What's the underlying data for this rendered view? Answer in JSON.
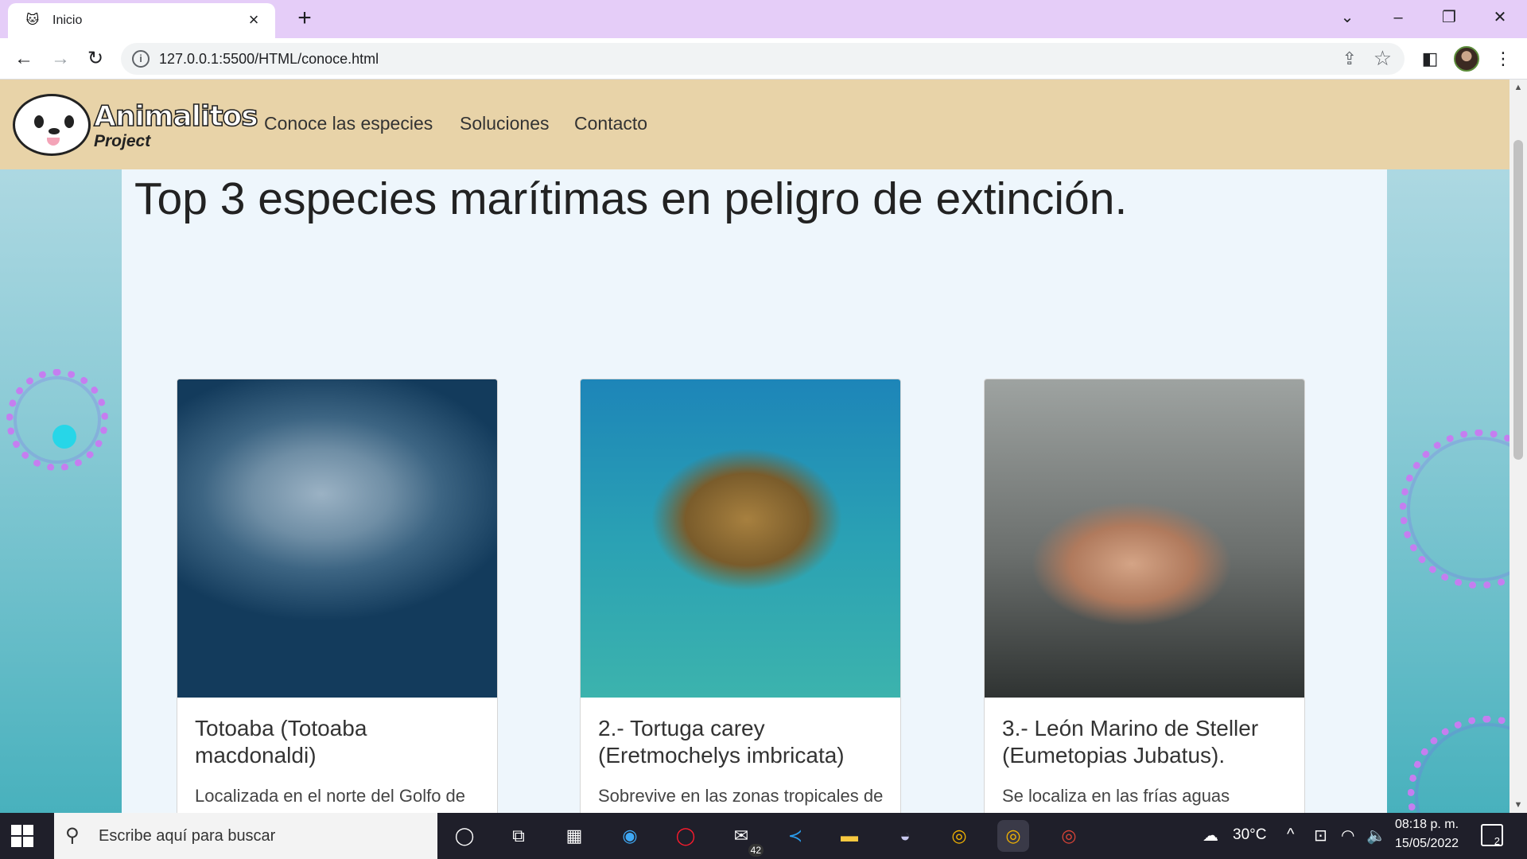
{
  "browser": {
    "tab_title": "Inicio",
    "tab_favicon": "🐱",
    "url": "127.0.0.1:5500/HTML/conoce.html"
  },
  "site": {
    "logo_word": "Animalitos",
    "logo_sub": "Project",
    "nav": [
      "Conoce las especies",
      "Soluciones",
      "Contacto"
    ],
    "heading": "Top 3 especies marítimas en peligro de extinción.",
    "cards": [
      {
        "title": "Totoaba (Totoaba macdonaldi)",
        "text": "Localizada en el norte del Golfo de California de México, este pez enfrenta desde hace décadas una dura caza furtiva",
        "image": "totoaba-fish-photo"
      },
      {
        "title": "2.- Tortuga carey (Eretmochelys imbricata)",
        "text": "Sobrevive en las zonas tropicales de los océanos, la población total de esta especie ha disminuido hasta un 80% en",
        "image": "hawksbill-turtle-photo"
      },
      {
        "title": "3.- León Marino de Steller (Eumetopias Jubatus).",
        "text": "Se localiza en las frías aguas costeras del Pacífico Norte. Es el miembro más grande de la familia Otariid y la cuarta",
        "image": "steller-sea-lion-photo"
      }
    ]
  },
  "taskbar": {
    "search_placeholder": "Escribe aquí para buscar",
    "mail_badge": "42",
    "temperature": "30°C",
    "time": "08:18 p. m.",
    "date": "15/05/2022",
    "notifications": "2"
  },
  "colors": {
    "tabbar": "#e5cdf8",
    "site_header": "#e8d3a8",
    "panel": "#eef6fc",
    "bubbles": "#c57ef0"
  }
}
